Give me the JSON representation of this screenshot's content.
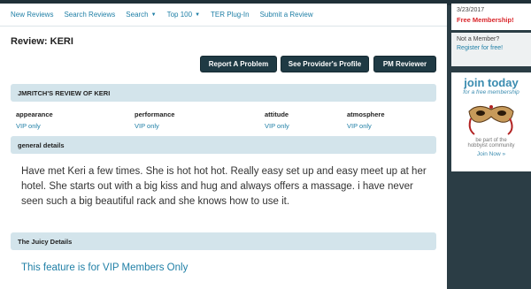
{
  "nav": {
    "items": [
      {
        "label": "New Reviews",
        "dropdown": false
      },
      {
        "label": "Search Reviews",
        "dropdown": false
      },
      {
        "label": "Search",
        "dropdown": true
      },
      {
        "label": "Top 100",
        "dropdown": true
      },
      {
        "label": "TER Plug-In",
        "dropdown": false
      },
      {
        "label": "Submit a Review",
        "dropdown": false
      }
    ]
  },
  "page_title": "Review: KERI",
  "actions": {
    "report": "Report A Problem",
    "profile": "See Provider's Profile",
    "pm": "PM Reviewer"
  },
  "review_header": "JMRITCH'S REVIEW OF KERI",
  "attributes": [
    {
      "label": "appearance",
      "value": "VIP only"
    },
    {
      "label": "performance",
      "value": "VIP only"
    },
    {
      "label": "attitude",
      "value": "VIP only"
    },
    {
      "label": "atmosphere",
      "value": "VIP only"
    }
  ],
  "general_details_header": "general details",
  "general_details_text": "Have met Keri a few times. She is hot hot hot. Really easy set up and easy meet up at her hotel. She starts out with a big kiss and hug and always offers a massage. i have never seen such a big beautiful rack and she knows how to use it.",
  "juicy_header": "The Juicy Details",
  "juicy_text": "This feature is for VIP Members Only",
  "sidebar": {
    "date": "3/23/2017",
    "free_membership": "Free Membership!",
    "not_member": "Not a Member?",
    "register": "Register for free!",
    "ad": {
      "title": "join today",
      "subtitle": "for a free membership",
      "part_of": "be part of the",
      "community": "hobbyist community",
      "join": "Join Now »"
    }
  },
  "colors": {
    "link": "#1f7fa6",
    "button_bg": "#1f3a44",
    "section_bg": "#d3e4eb",
    "accent_red": "#d9252a",
    "page_bg": "#2b3d45"
  }
}
